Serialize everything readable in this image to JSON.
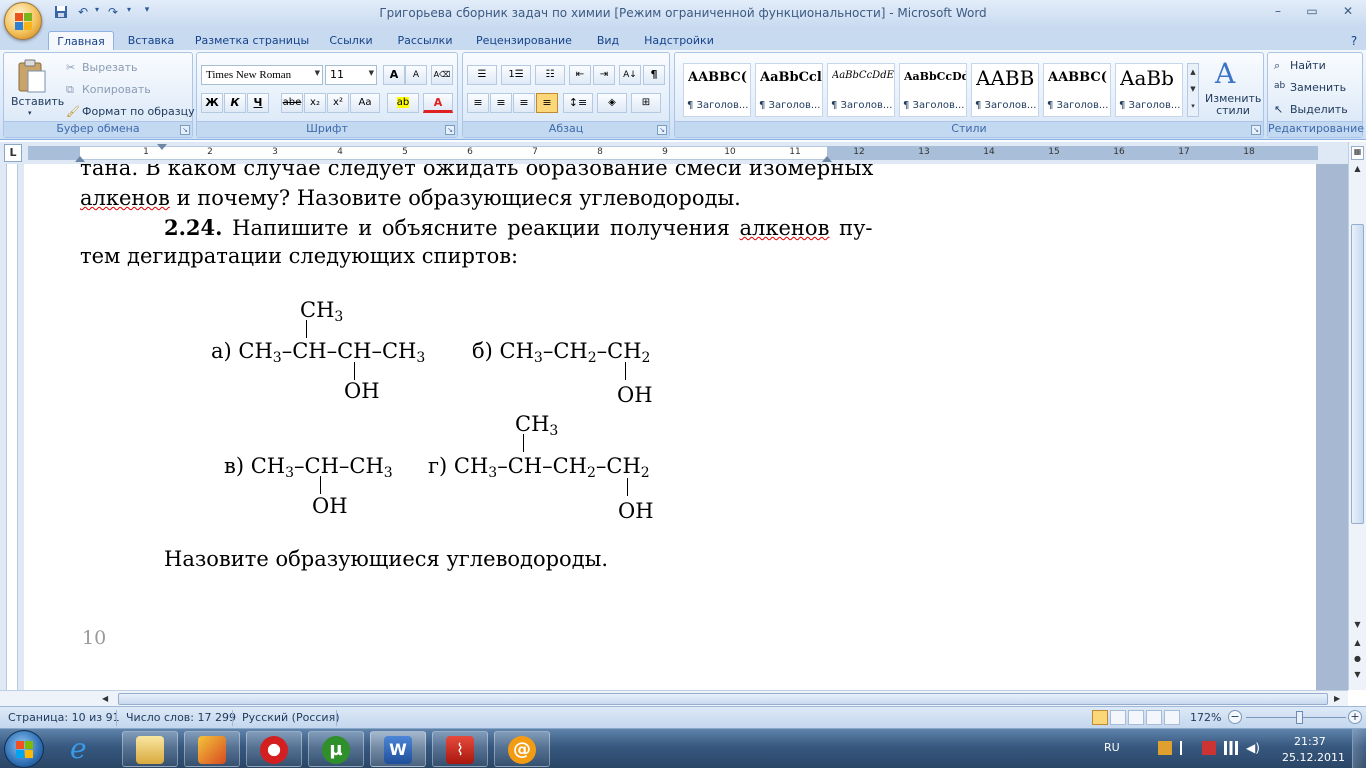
{
  "window": {
    "title": "Григорьева сборник задач по химии [Режим ограниченной функциональности] - Microsoft Word",
    "controls": {
      "minimize": "–",
      "maximize": "▭",
      "close": "✕"
    }
  },
  "quick_access": {
    "save_icon": "save-icon",
    "undo_icon": "undo-icon",
    "redo_icon": "redo-icon",
    "customize": "▾"
  },
  "tabs": [
    {
      "label": "Главная",
      "active": true
    },
    {
      "label": "Вставка"
    },
    {
      "label": "Разметка страницы"
    },
    {
      "label": "Ссылки"
    },
    {
      "label": "Рассылки"
    },
    {
      "label": "Рецензирование"
    },
    {
      "label": "Вид"
    },
    {
      "label": "Надстройки"
    }
  ],
  "ribbon": {
    "clipboard": {
      "label": "Буфер обмена",
      "paste": "Вставить",
      "cut": "Вырезать",
      "copy": "Копировать",
      "format_painter": "Формат по образцу"
    },
    "font": {
      "label": "Шрифт",
      "font_name": "Times New Roman",
      "font_size": "11",
      "grow": "A",
      "shrink": "A",
      "bold": "Ж",
      "italic": "К",
      "underline": "Ч",
      "strike": "abe",
      "subscript": "x₂",
      "superscript": "x²",
      "case": "Aa",
      "highlight": "ab",
      "font_color": "A",
      "highlight_color": "#ffff00",
      "font_color_value": "#e02020"
    },
    "paragraph": {
      "label": "Абзац",
      "pilcrow": "¶",
      "sort": "A↓"
    },
    "styles": {
      "label": "Стили",
      "items": [
        {
          "sample": "AABBC(",
          "name": "¶ Заголов..."
        },
        {
          "sample": "AaBbCcl",
          "name": "¶ Заголов..."
        },
        {
          "sample": "AaBbCcDdE",
          "name": "¶ Заголов..."
        },
        {
          "sample": "AaBbCcDdI",
          "name": "¶ Заголов..."
        },
        {
          "sample": "AABB",
          "name": "¶ Заголов..."
        },
        {
          "sample": "AABBC(",
          "name": "¶ Заголов..."
        },
        {
          "sample": "AaBb",
          "name": "¶ Заголов..."
        }
      ],
      "change": "Изменить стили"
    },
    "editing": {
      "label": "Редактирование",
      "find": "Найти",
      "replace": "Заменить",
      "select": "Выделить"
    }
  },
  "ruler": {
    "tab_selector": "L",
    "numbers": [
      "1",
      "1",
      "2",
      "3",
      "4",
      "5",
      "6",
      "7",
      "8",
      "9",
      "10",
      "11",
      "12",
      "13",
      "14",
      "15",
      "16",
      "17",
      "18"
    ]
  },
  "document": {
    "line1": "тана. В каком случае следует ожидать образование смеси изомерных",
    "line2_a": "алкенов",
    "line2_b": " и почему? Назовите образующиеся углеводороды.",
    "task_number": "2.24.",
    "line3_a": " Напишите и объясните реакции получения ",
    "line3_b": "алкенов",
    "line3_c": " пу-",
    "line4": "тем дегидратации следующих спиртов:",
    "formulas": {
      "a": {
        "label": "а)",
        "top": "CH",
        "top_sub": "3",
        "main": [
          "CH",
          "3",
          "–CH–CH–CH",
          "3"
        ],
        "bottom": "OH"
      },
      "b": {
        "label": "б)",
        "main": [
          "CH",
          "3",
          "–CH",
          "2",
          "–CH",
          "2"
        ],
        "bottom": "OH"
      },
      "v": {
        "label": "в)",
        "main": [
          "CH",
          "3",
          "–CH–CH",
          "3"
        ],
        "bottom": "OH"
      },
      "g": {
        "label": "г)",
        "top": "CH",
        "top_sub": "3",
        "main": [
          "CH",
          "3",
          "–CH–CH",
          "2",
          "–CH",
          "2"
        ],
        "bottom": "OH"
      }
    },
    "closing": "Назовите образующиеся углеводороды.",
    "page_number": "10"
  },
  "status": {
    "page": "Страница: 10 из 91",
    "words": "Число слов: 17 299",
    "language": "Русский (Россия)",
    "zoom": "172%",
    "zoom_minus": "−",
    "zoom_plus": "+"
  },
  "taskbar": {
    "apps": [
      "ie-icon",
      "explorer-icon",
      "paint-icon",
      "opera-icon",
      "utorrent-icon",
      "word-icon",
      "pdf-icon",
      "mail-icon"
    ],
    "lang": "RU",
    "time": "21:37",
    "date": "25.12.2011"
  }
}
